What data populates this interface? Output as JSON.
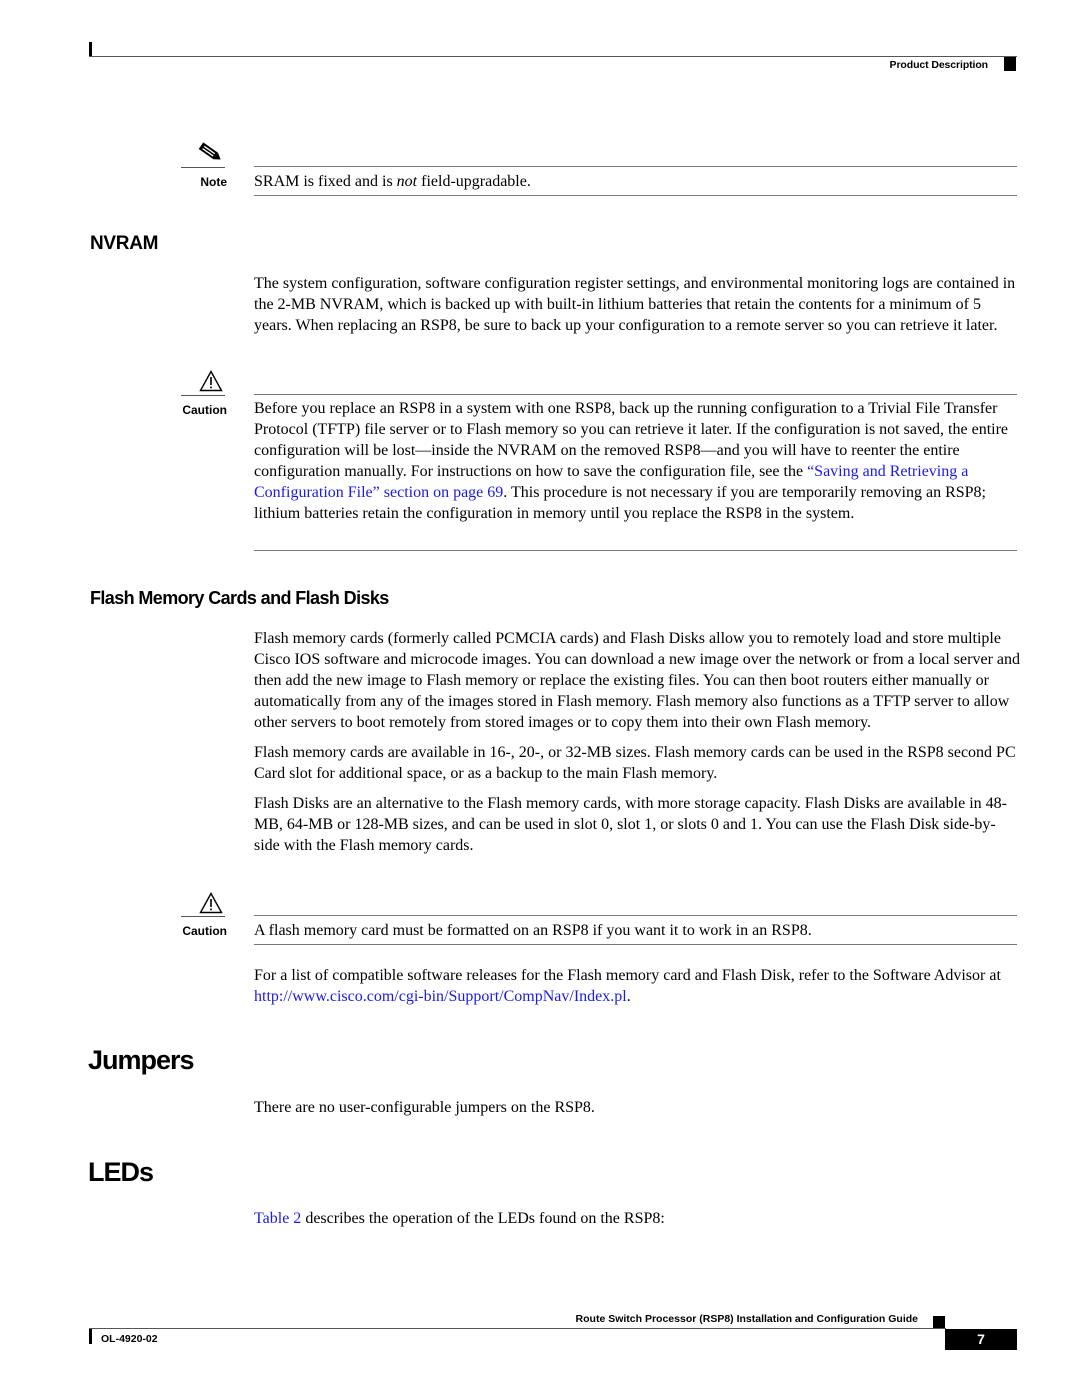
{
  "header": {
    "section_title": "Product Description"
  },
  "note": {
    "label": "Note",
    "icon": "pencil-note-icon",
    "text_before": "SRAM is fixed and is ",
    "text_emphasis": "not",
    "text_after": " field-upgradable."
  },
  "nvram": {
    "heading": "NVRAM",
    "paragraph": "The system configuration, software configuration register settings, and environmental monitoring logs are contained in the 2-MB NVRAM, which is backed up with built-in lithium batteries that retain the contents for a minimum of 5 years. When replacing an RSP8, be sure to back up your configuration to a remote server so you can retrieve it later.",
    "caution": {
      "label": "Caution",
      "icon": "warning-triangle-icon",
      "text_before": "Before you replace an RSP8 in a system with one RSP8, back up the running configuration to a Trivial File Transfer Protocol (TFTP) file server or to Flash memory so you can retrieve it later. If the configuration is not saved, the entire configuration will be lost—inside the NVRAM on the removed RSP8—and you will have to reenter the entire configuration manually. For instructions on how to save the configuration file, see the ",
      "link": "“Saving and Retrieving a Configuration File” section on page 69",
      "text_after": ". This procedure is not necessary if you are temporarily removing an RSP8; lithium batteries retain the configuration in memory until you replace the RSP8 in the system."
    }
  },
  "flash": {
    "heading": "Flash Memory Cards and Flash Disks",
    "paragraphs": [
      "Flash memory cards (formerly called PCMCIA cards) and Flash Disks allow you to remotely load and store multiple Cisco IOS software and microcode images. You can download a new image over the network or from a local server and then add the new image to Flash memory or replace the existing files. You can then boot routers either manually or automatically from any of the images stored in Flash memory. Flash memory also functions as a TFTP server to allow other servers to boot remotely from stored images or to copy them into their own Flash memory.",
      "Flash memory cards are available in 16-, 20-, or 32-MB sizes. Flash memory cards can be used in the RSP8 second PC Card slot for additional space, or as a backup to the main Flash memory.",
      "Flash Disks are an alternative to the Flash memory cards, with more storage capacity. Flash Disks are available in 48-MB, 64-MB or 128-MB sizes, and can be used in slot 0, slot 1, or slots 0 and 1. You can use the Flash Disk side-by-side with the Flash memory cards."
    ],
    "caution": {
      "label": "Caution",
      "icon": "warning-triangle-icon",
      "text": "A flash memory card must be formatted on an RSP8 if you want it to work in an RSP8."
    },
    "advisor_before": "For a list of compatible software releases for the Flash memory card and Flash Disk, refer to the Software Advisor at ",
    "advisor_link": "http://www.cisco.com/cgi-bin/Support/CompNav/Index.pl",
    "advisor_after": "."
  },
  "jumpers": {
    "heading": "Jumpers",
    "paragraph": "There are no user-configurable jumpers on the RSP8."
  },
  "leds": {
    "heading": "LEDs",
    "link": "Table 2",
    "text_after": " describes the operation of the LEDs found on the RSP8:"
  },
  "footer": {
    "guide_title": "Route Switch Processor (RSP8) Installation and Configuration Guide",
    "doc_number": "OL-4920-02",
    "page_number": "7"
  },
  "colors": {
    "link": "#1a1ae6",
    "text": "#000000",
    "rule": "#777777"
  }
}
